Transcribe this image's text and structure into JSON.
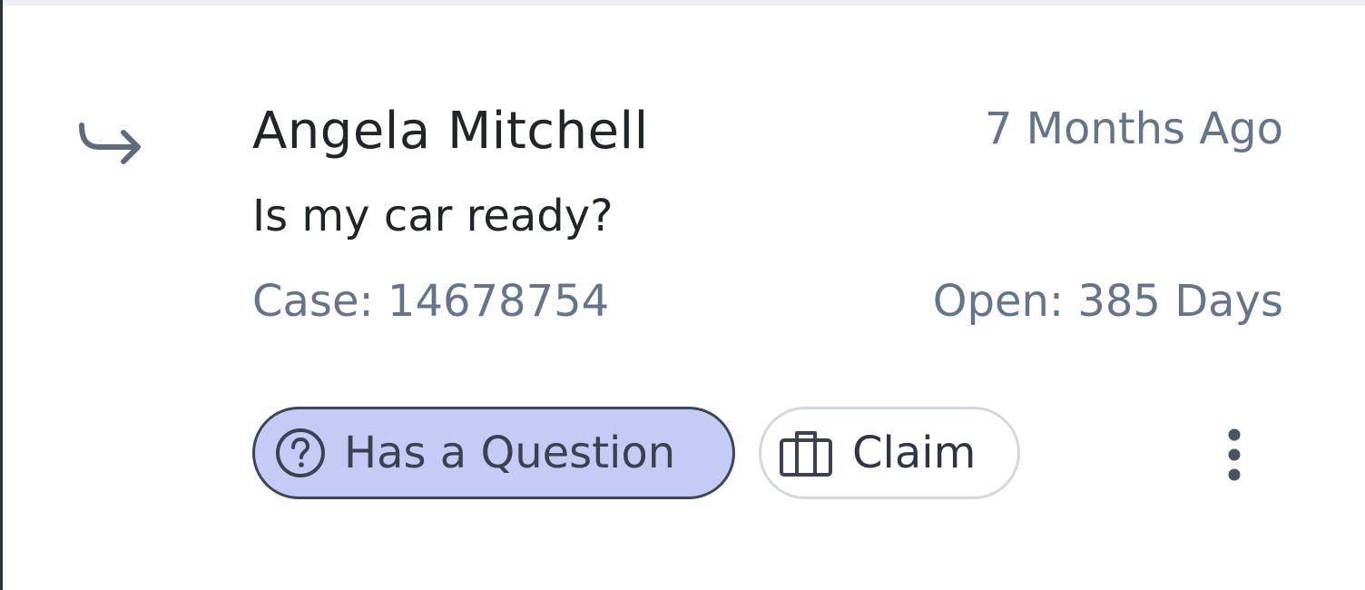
{
  "item": {
    "author": "Angela Mitchell",
    "timestamp": "7 Months Ago",
    "message": "Is my car ready?",
    "case_number": "Case: 14678754",
    "open_duration": "Open: 385 Days"
  },
  "tags": {
    "question_label": "Has a Question",
    "question_icon": "question-circle-icon",
    "question_bg": "#c5cbf4"
  },
  "actions": {
    "claim_label": "Claim",
    "claim_icon": "briefcase-icon",
    "reply_icon": "reply-arrow-icon",
    "more_icon": "vertical-dots-icon"
  },
  "colors": {
    "primary_text": "#212529",
    "muted_text": "#64748b",
    "border_dark": "#3d4656"
  }
}
